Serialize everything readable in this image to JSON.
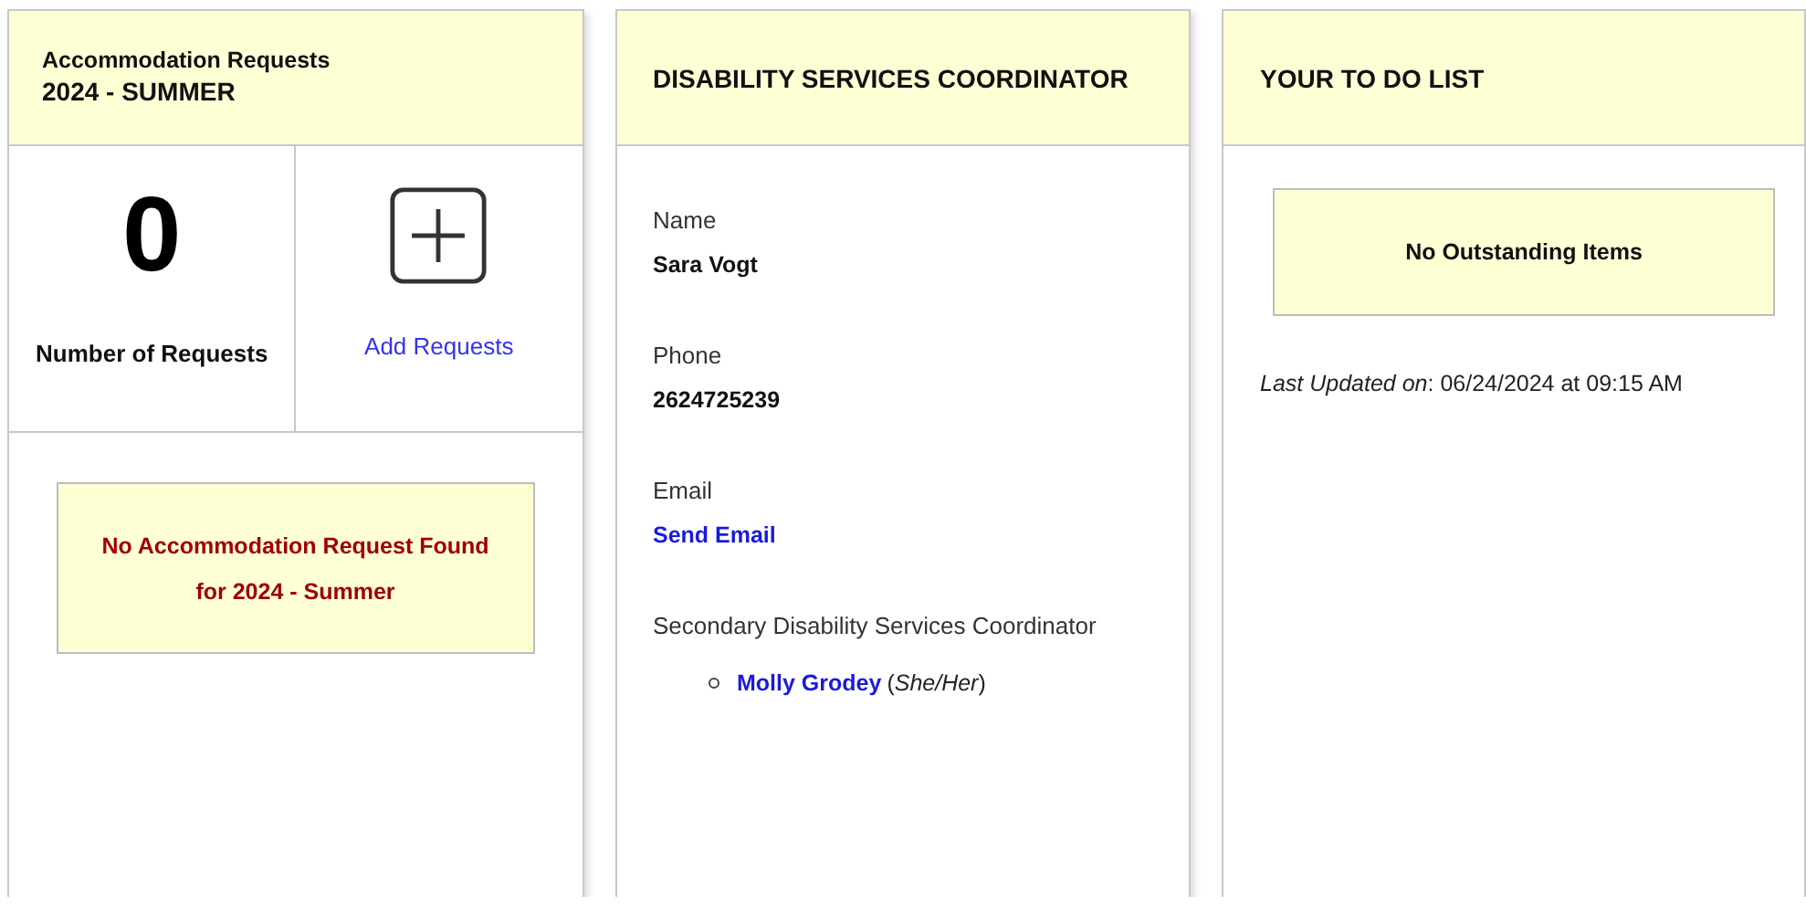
{
  "requests_card": {
    "title": "Accommodation Requests",
    "term": "2024 - SUMMER",
    "count": "0",
    "count_label": "Number of Requests",
    "add_label": "Add Requests",
    "notice": [
      "No Accommodation Request Found",
      "for 2024 - Summer"
    ]
  },
  "coordinator_card": {
    "title": "DISABILITY SERVICES COORDINATOR",
    "fields": [
      {
        "label": "Name",
        "value": "Sara Vogt",
        "kind": "text"
      },
      {
        "label": "Phone",
        "value": "2624725239",
        "kind": "text"
      },
      {
        "label": "Email",
        "value": "Send Email",
        "kind": "link"
      }
    ],
    "secondary_label": "Secondary Disability Services Coordinator",
    "secondary": [
      {
        "name": "Molly Grodey",
        "pronouns": "(*She/Her*)"
      }
    ]
  },
  "todo_card": {
    "title": "YOUR TO DO LIST",
    "notice": "No Outstanding Items",
    "updated": "*Last Updated on*: 06/24/2024 at 09:15 AM"
  }
}
